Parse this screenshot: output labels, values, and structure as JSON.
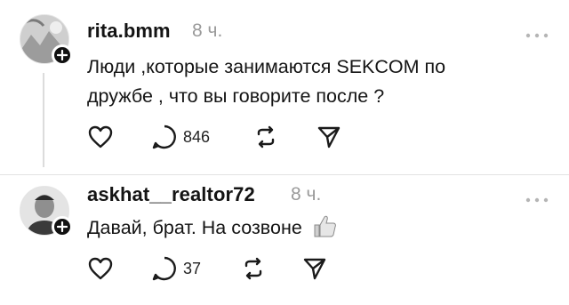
{
  "posts": [
    {
      "username": "rita.bmm",
      "time": "8 ч.",
      "text": "Люди ,которые занимаются SEKCOM по дружбе , что вы говорите после ?",
      "comments_count": "846",
      "icons": [
        "like-icon",
        "comment-icon",
        "repost-icon",
        "share-icon"
      ]
    },
    {
      "username": "askhat__realtor72",
      "time": "8 ч.",
      "text": "Давай, брат. На созвоне",
      "emoji": "thumbs-up",
      "comments_count": "37",
      "icons": [
        "like-icon",
        "comment-icon",
        "repost-icon",
        "share-icon"
      ]
    }
  ]
}
